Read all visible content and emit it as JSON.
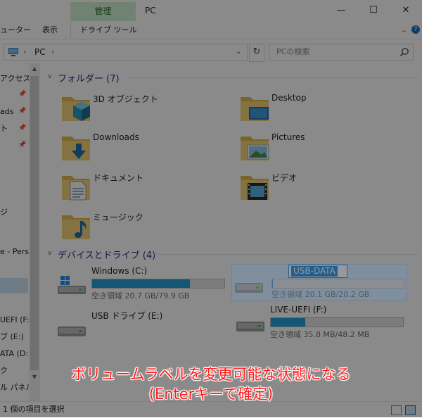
{
  "window": {
    "title": "PC",
    "context_tab": "管理",
    "min_glyph": "—",
    "max_glyph": "☐",
    "close_glyph": "✕"
  },
  "ribbon": {
    "tabs": [
      "ューター",
      "表示",
      "ドライブ ツール"
    ],
    "expand_glyph": "⌄",
    "help_glyph": "?"
  },
  "address": {
    "arrow": "›",
    "crumb": "PC",
    "dropdown_glyph": "⌄",
    "refresh_glyph": "↻"
  },
  "search": {
    "placeholder": "PCの検索"
  },
  "nav": {
    "items": [
      "アクセス",
      "",
      "ads",
      "ト",
      "",
      "",
      "",
      "",
      "",
      "",
      "",
      "ジ",
      "",
      "",
      "e - Perso",
      "",
      "",
      "",
      "",
      "",
      "",
      "UEFI (F:)",
      "ブ (E:)",
      "ATA (D:)",
      "ク",
      "ル パネル"
    ]
  },
  "folders_group": {
    "header": "フォルダー (7)",
    "chevron": "v",
    "items": [
      {
        "label": "3D オブジェクト",
        "icon": "3d-objects-folder-icon"
      },
      {
        "label": "Desktop",
        "icon": "desktop-folder-icon"
      },
      {
        "label": "Downloads",
        "icon": "downloads-folder-icon"
      },
      {
        "label": "Pictures",
        "icon": "pictures-folder-icon"
      },
      {
        "label": "ドキュメント",
        "icon": "documents-folder-icon"
      },
      {
        "label": "ビデオ",
        "icon": "videos-folder-icon"
      },
      {
        "label": "ミュージック",
        "icon": "music-folder-icon"
      }
    ]
  },
  "drives_group": {
    "header": "デバイスとドライブ (4)",
    "chevron": "v",
    "items": [
      {
        "name": "Windows (C:)",
        "free_text": "空き領域 20.7 GB/79.9 GB",
        "used_fraction": 0.74,
        "icon": "windows-drive-icon"
      },
      {
        "name": "USB-DATA",
        "free_text": "空き領域 20.1 GB/20.2 GB",
        "used_fraction": 0.005,
        "icon": "usb-drive-icon",
        "editing": true
      },
      {
        "name": "USB ドライブ (E:)",
        "free_text": "",
        "used_fraction": null,
        "icon": "usb-drive-icon"
      },
      {
        "name": "LIVE-UEFI (F:)",
        "free_text": "空き領域 35.8 MB/48.2 MB",
        "used_fraction": 0.26,
        "icon": "usb-drive-icon"
      }
    ]
  },
  "status": {
    "text": "1 個の項目を選択"
  },
  "caption": {
    "line1": "ボリュームラベルを変更可能な状態になる",
    "line2": "(Enterキーで確定)"
  },
  "colors": {
    "accent": "#0078d7",
    "bar_fill": "#26a0da",
    "caption": "#ff1a1a",
    "context_tab": "#d3f1d3"
  }
}
